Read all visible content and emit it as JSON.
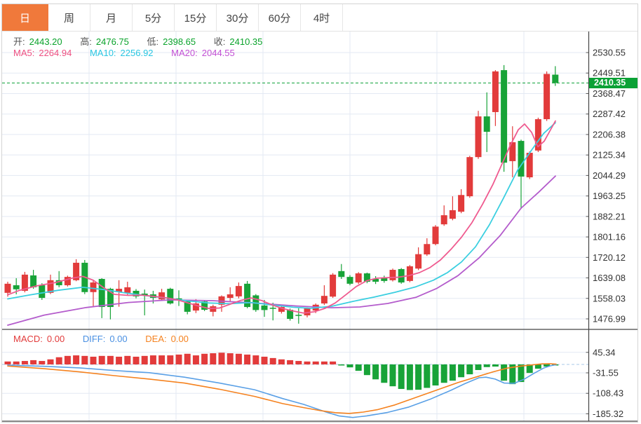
{
  "toolbar": {
    "tabs": [
      {
        "label": "日",
        "active": true
      },
      {
        "label": "周",
        "active": false
      },
      {
        "label": "月",
        "active": false
      },
      {
        "label": "5分",
        "active": false
      },
      {
        "label": "15分",
        "active": false
      },
      {
        "label": "30分",
        "active": false
      },
      {
        "label": "60分",
        "active": false
      },
      {
        "label": "4时",
        "active": false
      }
    ]
  },
  "ohlc_header": {
    "open_label": "开:",
    "open_value": "2443.20",
    "high_label": "高:",
    "high_value": "2476.75",
    "low_label": "低:",
    "low_value": "2398.65",
    "close_label": "收:",
    "close_value": "2410.35"
  },
  "ma_header": {
    "ma5_label": "MA5:",
    "ma5_value": "2264.94",
    "ma10_label": "MA10:",
    "ma10_value": "2256.92",
    "ma20_label": "MA20:",
    "ma20_value": "2044.55"
  },
  "macd_header": {
    "macd_label": "MACD:",
    "macd_value": "0.00",
    "diff_label": "DIFF:",
    "diff_value": "0.00",
    "dea_label": "DEA:",
    "dea_value": "0.00"
  },
  "price_axis": {
    "ticks": [
      "2530.55",
      "2449.51",
      "2368.47",
      "2287.42",
      "2206.38",
      "2125.34",
      "2044.29",
      "1963.25",
      "1882.21",
      "1801.16",
      "1720.12",
      "1639.08",
      "1558.03",
      "1476.99"
    ],
    "current_price": "2410.35"
  },
  "macd_axis": {
    "ticks": [
      "45.34",
      "-31.55",
      "-108.43",
      "-185.32"
    ]
  },
  "colors": {
    "up": "#e23b3b",
    "down": "#18a338",
    "ma5": "#ef5a8f",
    "ma10": "#3bcfe0",
    "ma20": "#b45ccc",
    "diff_line": "#5aa0e6",
    "dea_line": "#f5821f",
    "price_line": "#0aa135",
    "zero_line": "#a9c9e9",
    "grid": "#e3e9f3",
    "axis": "#444444",
    "tick_text": "#333333",
    "accent_tab": "#f0793b"
  },
  "chart_data": {
    "type": "candlestick",
    "indicator": "MACD",
    "timeframe": "日",
    "candles": [
      [
        1580,
        1624,
        1565,
        1616
      ],
      [
        1610,
        1638,
        1574,
        1594
      ],
      [
        1588,
        1663,
        1582,
        1652
      ],
      [
        1649,
        1671,
        1596,
        1602
      ],
      [
        1610,
        1618,
        1552,
        1560
      ],
      [
        1580,
        1652,
        1575,
        1630
      ],
      [
        1630,
        1666,
        1602,
        1610
      ],
      [
        1610,
        1648,
        1605,
        1643
      ],
      [
        1630,
        1713,
        1626,
        1699
      ],
      [
        1699,
        1710,
        1575,
        1583
      ],
      [
        1583,
        1628,
        1524,
        1621
      ],
      [
        1635,
        1638,
        1480,
        1524
      ],
      [
        1596,
        1600,
        1475,
        1524
      ],
      [
        1583,
        1630,
        1525,
        1596
      ],
      [
        1580,
        1624,
        1572,
        1602
      ],
      [
        1588,
        1595,
        1558,
        1566
      ],
      [
        1577,
        1593,
        1491,
        1571
      ],
      [
        1574,
        1588,
        1538,
        1560
      ],
      [
        1554,
        1596,
        1548,
        1582
      ],
      [
        1596,
        1600,
        1534,
        1538
      ],
      [
        1558,
        1590,
        1528,
        1552
      ],
      [
        1546,
        1550,
        1495,
        1505
      ],
      [
        1510,
        1555,
        1500,
        1538
      ],
      [
        1546,
        1550,
        1508,
        1513
      ],
      [
        1505,
        1533,
        1487,
        1527
      ],
      [
        1533,
        1570,
        1505,
        1566
      ],
      [
        1560,
        1602,
        1546,
        1574
      ],
      [
        1566,
        1621,
        1558,
        1607
      ],
      [
        1616,
        1627,
        1519,
        1524
      ],
      [
        1570,
        1575,
        1505,
        1512
      ],
      [
        1530,
        1552,
        1485,
        1512
      ],
      [
        1521,
        1541,
        1471,
        1517
      ],
      [
        1505,
        1528,
        1498,
        1524
      ],
      [
        1513,
        1518,
        1470,
        1477
      ],
      [
        1493,
        1519,
        1458,
        1489
      ],
      [
        1491,
        1522,
        1483,
        1519
      ],
      [
        1510,
        1538,
        1500,
        1533
      ],
      [
        1538,
        1610,
        1532,
        1568
      ],
      [
        1565,
        1658,
        1560,
        1652
      ],
      [
        1666,
        1694,
        1635,
        1643
      ],
      [
        1643,
        1650,
        1610,
        1616
      ],
      [
        1621,
        1662,
        1615,
        1657
      ],
      [
        1657,
        1660,
        1618,
        1624
      ],
      [
        1635,
        1646,
        1615,
        1624
      ],
      [
        1638,
        1648,
        1620,
        1627
      ],
      [
        1630,
        1676,
        1625,
        1671
      ],
      [
        1674,
        1678,
        1616,
        1621
      ],
      [
        1627,
        1690,
        1622,
        1685
      ],
      [
        1676,
        1760,
        1670,
        1733
      ],
      [
        1732,
        1796,
        1726,
        1773
      ],
      [
        1773,
        1848,
        1768,
        1842
      ],
      [
        1851,
        1926,
        1845,
        1887
      ],
      [
        1873,
        1962,
        1867,
        1907
      ],
      [
        1901,
        1990,
        1895,
        1967
      ],
      [
        1962,
        2122,
        1956,
        2117
      ],
      [
        2117,
        2300,
        2110,
        2278
      ],
      [
        2278,
        2373,
        2137,
        2217
      ],
      [
        2295,
        2461,
        2240,
        2456
      ],
      [
        2461,
        2481,
        2059,
        2095
      ],
      [
        2101,
        2239,
        2037,
        2176
      ],
      [
        2181,
        2186,
        1912,
        2040
      ],
      [
        2037,
        2140,
        2030,
        2134
      ],
      [
        2143,
        2273,
        2137,
        2267
      ],
      [
        2267,
        2456,
        2260,
        2446
      ],
      [
        2443.2,
        2476.75,
        2398.65,
        2410.35
      ]
    ],
    "current_price_value": 2410.35,
    "ma_lines": [
      {
        "name": "MA20",
        "period": 20,
        "points": [
          [
            8,
            1452
          ],
          [
            60,
            1492
          ],
          [
            120,
            1522
          ],
          [
            180,
            1542
          ],
          [
            240,
            1552
          ],
          [
            300,
            1549
          ],
          [
            360,
            1540
          ],
          [
            420,
            1528
          ],
          [
            470,
            1521
          ],
          [
            510,
            1524
          ],
          [
            550,
            1538
          ],
          [
            590,
            1562
          ],
          [
            620,
            1598
          ],
          [
            650,
            1648
          ],
          [
            680,
            1718
          ],
          [
            710,
            1806
          ],
          [
            740,
            1915
          ],
          [
            765,
            1978
          ],
          [
            789,
            2042
          ]
        ]
      },
      {
        "name": "MA10",
        "period": 10,
        "points": [
          [
            8,
            1556
          ],
          [
            40,
            1572
          ],
          [
            80,
            1590
          ],
          [
            115,
            1602
          ],
          [
            145,
            1593
          ],
          [
            175,
            1580
          ],
          [
            205,
            1569
          ],
          [
            235,
            1559
          ],
          [
            265,
            1548
          ],
          [
            295,
            1540
          ],
          [
            325,
            1537
          ],
          [
            355,
            1542
          ],
          [
            385,
            1532
          ],
          [
            415,
            1523
          ],
          [
            440,
            1519
          ],
          [
            470,
            1527
          ],
          [
            500,
            1546
          ],
          [
            530,
            1563
          ],
          [
            560,
            1582
          ],
          [
            590,
            1604
          ],
          [
            615,
            1630
          ],
          [
            635,
            1660
          ],
          [
            655,
            1702
          ],
          [
            675,
            1762
          ],
          [
            695,
            1850
          ],
          [
            715,
            1955
          ],
          [
            735,
            2065
          ],
          [
            755,
            2145
          ],
          [
            772,
            2210
          ],
          [
            789,
            2253
          ]
        ]
      },
      {
        "name": "MA5",
        "period": 5,
        "points": [
          [
            8,
            1572
          ],
          [
            25,
            1590
          ],
          [
            50,
            1608
          ],
          [
            75,
            1620
          ],
          [
            100,
            1638
          ],
          [
            115,
            1645
          ],
          [
            130,
            1630
          ],
          [
            145,
            1600
          ],
          [
            160,
            1574
          ],
          [
            180,
            1570
          ],
          [
            200,
            1571
          ],
          [
            220,
            1565
          ],
          [
            235,
            1560
          ],
          [
            250,
            1552
          ],
          [
            265,
            1540
          ],
          [
            280,
            1528
          ],
          [
            295,
            1518
          ],
          [
            310,
            1520
          ],
          [
            325,
            1535
          ],
          [
            340,
            1550
          ],
          [
            355,
            1560
          ],
          [
            370,
            1550
          ],
          [
            385,
            1532
          ],
          [
            400,
            1518
          ],
          [
            415,
            1508
          ],
          [
            430,
            1500
          ],
          [
            445,
            1505
          ],
          [
            460,
            1518
          ],
          [
            475,
            1540
          ],
          [
            490,
            1572
          ],
          [
            505,
            1605
          ],
          [
            520,
            1628
          ],
          [
            535,
            1638
          ],
          [
            550,
            1640
          ],
          [
            565,
            1642
          ],
          [
            580,
            1648
          ],
          [
            595,
            1660
          ],
          [
            610,
            1680
          ],
          [
            625,
            1710
          ],
          [
            640,
            1752
          ],
          [
            655,
            1800
          ],
          [
            670,
            1858
          ],
          [
            685,
            1930
          ],
          [
            700,
            2010
          ],
          [
            712,
            2085
          ],
          [
            724,
            2160
          ],
          [
            736,
            2225
          ],
          [
            745,
            2248
          ],
          [
            755,
            2215
          ],
          [
            764,
            2158
          ],
          [
            773,
            2180
          ],
          [
            781,
            2220
          ],
          [
            789,
            2260
          ]
        ]
      }
    ],
    "macd": {
      "hist": [
        11,
        11,
        13,
        16,
        13,
        19,
        27,
        32,
        34,
        32,
        29,
        32,
        32,
        29,
        32,
        29,
        32,
        34,
        34,
        34,
        37,
        40,
        34,
        40,
        42,
        44,
        42,
        40,
        37,
        34,
        29,
        24,
        19,
        16,
        13,
        11,
        11,
        11,
        11,
        -3,
        -11,
        -24,
        -40,
        -56,
        -69,
        -82,
        -92,
        -96,
        -95,
        -88,
        -79,
        -69,
        -61,
        -48,
        -37,
        -21,
        -10,
        -8,
        -61,
        -74,
        -66,
        -32,
        -16,
        -8,
        -2
      ],
      "diff_points": [
        [
          8,
          -3
        ],
        [
          60,
          -7
        ],
        [
          110,
          -13
        ],
        [
          160,
          -23
        ],
        [
          210,
          -31
        ],
        [
          260,
          -48
        ],
        [
          310,
          -70
        ],
        [
          360,
          -95
        ],
        [
          400,
          -128
        ],
        [
          430,
          -150
        ],
        [
          460,
          -177
        ],
        [
          480,
          -193
        ],
        [
          500,
          -199
        ],
        [
          520,
          -193
        ],
        [
          550,
          -180
        ],
        [
          580,
          -160
        ],
        [
          610,
          -131
        ],
        [
          640,
          -97
        ],
        [
          660,
          -72
        ],
        [
          680,
          -50
        ],
        [
          690,
          -48
        ],
        [
          703,
          -55
        ],
        [
          716,
          -70
        ],
        [
          730,
          -71
        ],
        [
          744,
          -56
        ],
        [
          758,
          -34
        ],
        [
          772,
          -14
        ],
        [
          782,
          -5
        ],
        [
          790,
          -1
        ]
      ],
      "dea_points": [
        [
          8,
          -6
        ],
        [
          60,
          -16
        ],
        [
          110,
          -28
        ],
        [
          160,
          -42
        ],
        [
          210,
          -55
        ],
        [
          260,
          -70
        ],
        [
          310,
          -93
        ],
        [
          360,
          -120
        ],
        [
          400,
          -147
        ],
        [
          430,
          -162
        ],
        [
          455,
          -174
        ],
        [
          475,
          -181
        ],
        [
          495,
          -184
        ],
        [
          515,
          -179
        ],
        [
          535,
          -170
        ],
        [
          560,
          -152
        ],
        [
          590,
          -124
        ],
        [
          620,
          -96
        ],
        [
          650,
          -68
        ],
        [
          680,
          -44
        ],
        [
          700,
          -28
        ],
        [
          720,
          -14
        ],
        [
          740,
          -6
        ],
        [
          758,
          -1
        ],
        [
          770,
          2
        ],
        [
          780,
          3
        ],
        [
          790,
          1
        ]
      ]
    },
    "ylim_main": [
      1476.99,
      2530.55
    ],
    "ylim_macd": [
      -185.32,
      45.34
    ],
    "grid": true,
    "up_convention": "red-up / green-down (CN)"
  }
}
